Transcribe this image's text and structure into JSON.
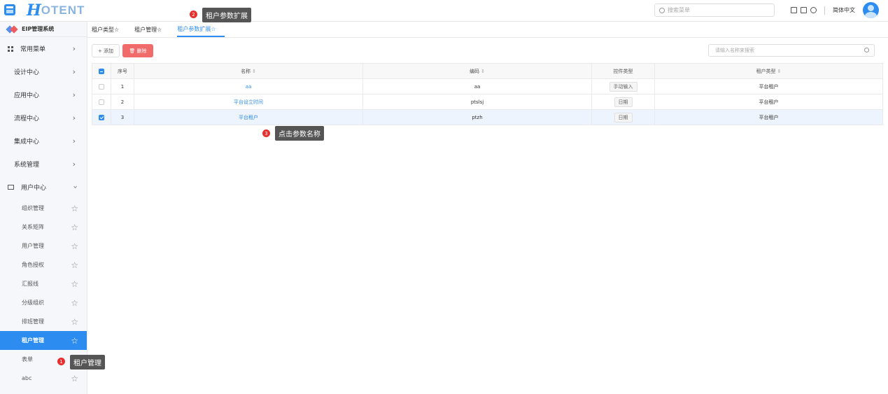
{
  "header": {
    "logo_h": "H",
    "logo_rest": "OTENT",
    "search_placeholder": "搜索菜单",
    "language": "简体中文"
  },
  "sidebar": {
    "system_title": "EIP管理系统",
    "menus": [
      {
        "label": "常用菜单"
      },
      {
        "label": "设计中心"
      },
      {
        "label": "应用中心"
      },
      {
        "label": "流程中心"
      },
      {
        "label": "集成中心"
      },
      {
        "label": "系统管理"
      },
      {
        "label": "用户中心"
      }
    ],
    "sub_items": [
      {
        "label": "组织管理"
      },
      {
        "label": "关系矩阵"
      },
      {
        "label": "用户管理"
      },
      {
        "label": "角色授权"
      },
      {
        "label": "汇报线"
      },
      {
        "label": "分级组织"
      },
      {
        "label": "排班管理"
      },
      {
        "label": "租户管理"
      },
      {
        "label": "表单"
      },
      {
        "label": "abc"
      }
    ]
  },
  "tabs": [
    {
      "label": "租户类型☆"
    },
    {
      "label": "租户管理☆"
    },
    {
      "label": "租户参数扩展☆"
    }
  ],
  "toolbar": {
    "add_label": "+ 添加",
    "delete_label": "🗑 删除",
    "search_placeholder": "请输入名称来搜索"
  },
  "table": {
    "columns": {
      "index": "序号",
      "name": "名称",
      "code": "编码",
      "control": "控件类型",
      "tenant_type": "租户类型"
    },
    "rows": [
      {
        "index": "1",
        "name": "aa",
        "code": "aa",
        "control": "手动输入",
        "tenant_type": "平台租户"
      },
      {
        "index": "2",
        "name": "平台设立时间",
        "code": "ptslsj",
        "control": "日期",
        "tenant_type": "平台租户"
      },
      {
        "index": "3",
        "name": "平台租户",
        "code": "ptzh",
        "control": "日期",
        "tenant_type": "平台租户"
      }
    ]
  },
  "annotations": [
    {
      "num": "1",
      "text": "租户管理"
    },
    {
      "num": "2",
      "text": "租户参数扩展"
    },
    {
      "num": "3",
      "text": "点击参数名称"
    }
  ]
}
